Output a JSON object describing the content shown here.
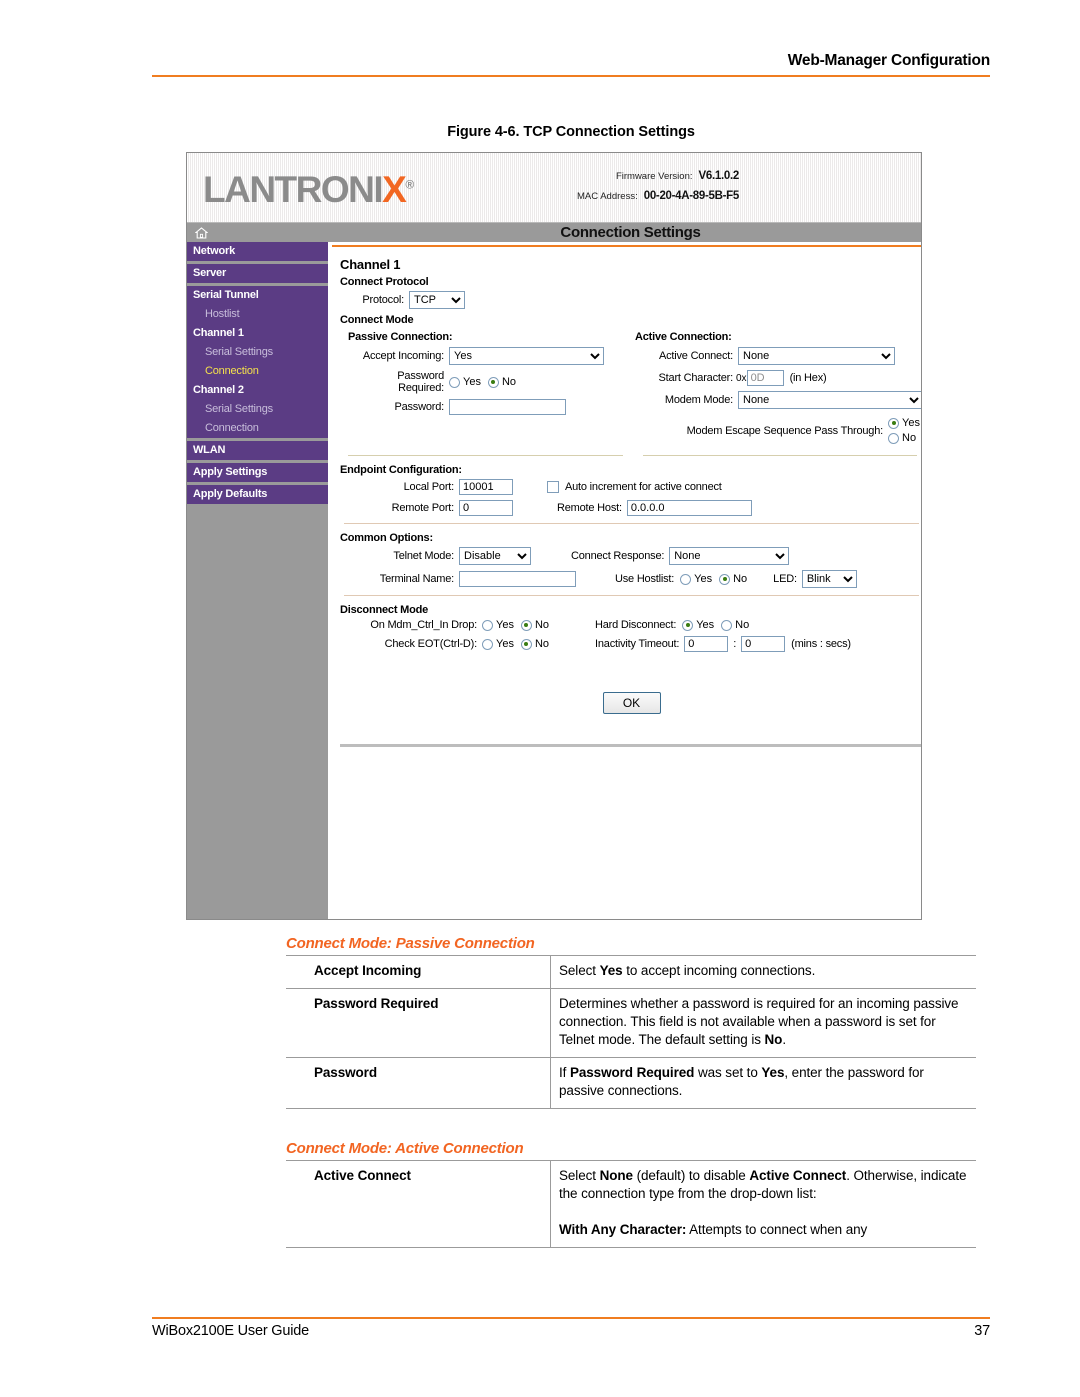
{
  "page": {
    "header_title": "Web-Manager Configuration",
    "figure_caption": "Figure 4-6. TCP Connection Settings",
    "footer_left": "WiBox2100E User Guide",
    "footer_page": "37",
    "accent_orange": "#F07D20",
    "purple": "#5B3C84",
    "gray": "#9A9A9A"
  },
  "webpanel": {
    "logo_text": "LANTRONI",
    "logo_x": "X",
    "logo_reg": "®",
    "firmware_label": "Firmware Version:",
    "firmware_value": "V6.1.0.2",
    "mac_label": "MAC Address:",
    "mac_value": "00-20-4A-89-5B-F5",
    "main_title": "Connection Settings",
    "nav": [
      {
        "label": "Network",
        "sub": false,
        "active": false
      },
      {
        "label": "Server",
        "sub": false,
        "active": false
      },
      {
        "label": "Serial Tunnel",
        "sub": false,
        "active": false
      },
      {
        "label": "Hostlist",
        "sub": true,
        "active": false
      },
      {
        "label": "Channel 1",
        "sub": false,
        "active": false
      },
      {
        "label": "Serial Settings",
        "sub": true,
        "active": false
      },
      {
        "label": "Connection",
        "sub": true,
        "active": true
      },
      {
        "label": "Channel 2",
        "sub": false,
        "active": false
      },
      {
        "label": "Serial Settings",
        "sub": true,
        "active": false
      },
      {
        "label": "Connection",
        "sub": true,
        "active": false
      },
      {
        "label": "WLAN",
        "sub": false,
        "active": false
      },
      {
        "label": "Apply Settings",
        "sub": false,
        "active": false
      },
      {
        "label": "Apply Defaults",
        "sub": false,
        "active": false
      }
    ],
    "channel_heading": "Channel 1",
    "connect_protocol_heading": "Connect Protocol",
    "protocol_label": "Protocol:",
    "protocol_value": "TCP",
    "connect_mode_heading": "Connect Mode",
    "passive_heading": "Passive Connection:",
    "active_heading": "Active Connection:",
    "accept_incoming_label": "Accept Incoming:",
    "accept_incoming_value": "Yes",
    "password_required_label": "Password Required:",
    "password_required_line1": "Password",
    "password_required_line2": "Required:",
    "password_required_value": "No",
    "password_label": "Password:",
    "password_value": "",
    "active_connect_label": "Active Connect:",
    "active_connect_value": "None",
    "start_character_label": "Start Character:",
    "start_character_prefix": "0x",
    "start_character_value": "0D",
    "start_character_suffix": "(in Hex)",
    "modem_mode_label": "Modem Mode:",
    "modem_mode_value": "None",
    "modem_escape_label": "Modem Escape Sequence Pass Through:",
    "modem_escape_value": "Yes",
    "yes_label": "Yes",
    "no_label": "No",
    "endpoint_heading": "Endpoint Configuration:",
    "local_port_label": "Local Port:",
    "local_port_value": "10001",
    "auto_increment_label": "Auto increment for active connect",
    "auto_increment_checked": false,
    "remote_port_label": "Remote Port:",
    "remote_port_value": "0",
    "remote_host_label": "Remote Host:",
    "remote_host_value": "0.0.0.0",
    "common_heading": "Common Options:",
    "telnet_mode_label": "Telnet Mode:",
    "telnet_mode_value": "Disable",
    "connect_response_label": "Connect Response:",
    "connect_response_value": "None",
    "terminal_name_label": "Terminal Name:",
    "terminal_name_value": "",
    "use_hostlist_label": "Use Hostlist:",
    "use_hostlist_value": "No",
    "led_label": "LED:",
    "led_value": "Blink",
    "disconnect_heading": "Disconnect Mode",
    "mdm_ctrl_label": "On Mdm_Ctrl_In Drop:",
    "mdm_ctrl_value": "No",
    "check_eot_label": "Check EOT(Ctrl-D):",
    "check_eot_value": "No",
    "hard_disconnect_label": "Hard Disconnect:",
    "hard_disconnect_value": "Yes",
    "inactivity_label": "Inactivity Timeout:",
    "inactivity_mins": "0",
    "inactivity_secs": "0",
    "inactivity_colon": ":",
    "inactivity_units": "(mins : secs)",
    "ok_label": "OK",
    "home_icon": "home-icon"
  },
  "sections": [
    {
      "heading": "Connect Mode: Passive Connection",
      "rows": [
        {
          "key": "Accept Incoming",
          "paras": [
            [
              {
                "t": "Select ",
                "b": false
              },
              {
                "t": "Yes",
                "b": true
              },
              {
                "t": " to accept incoming connections.",
                "b": false
              }
            ]
          ]
        },
        {
          "key": "Password Required",
          "paras": [
            [
              {
                "t": "Determines whether a password is required for an incoming passive connection. This field is not available when a password is set for Telnet mode. The default setting is ",
                "b": false
              },
              {
                "t": "No",
                "b": true
              },
              {
                "t": ".",
                "b": false
              }
            ]
          ]
        },
        {
          "key": "Password",
          "paras": [
            [
              {
                "t": "If ",
                "b": false
              },
              {
                "t": "Password Required",
                "b": true
              },
              {
                "t": " was set to ",
                "b": false
              },
              {
                "t": "Yes",
                "b": true
              },
              {
                "t": ", enter the password for passive connections.",
                "b": false
              }
            ]
          ]
        }
      ]
    },
    {
      "heading": "Connect Mode: Active Connection",
      "rows": [
        {
          "key": "Active Connect",
          "paras": [
            [
              {
                "t": "Select ",
                "b": false
              },
              {
                "t": "None",
                "b": true
              },
              {
                "t": " (default) to disable ",
                "b": false
              },
              {
                "t": "Active Connect",
                "b": true
              },
              {
                "t": ". Otherwise, indicate the connection type from the drop-down list:",
                "b": false
              }
            ],
            [],
            [
              {
                "t": "With Any Character:",
                "b": true
              },
              {
                "t": " Attempts to connect when any",
                "b": false
              }
            ]
          ]
        }
      ]
    }
  ]
}
